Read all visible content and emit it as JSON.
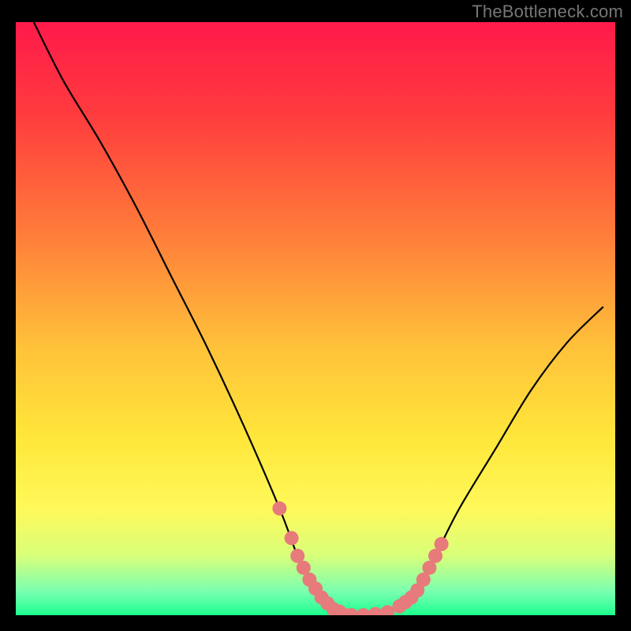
{
  "attribution": "TheBottleneck.com",
  "chart_data": {
    "type": "line",
    "title": "",
    "xlabel": "",
    "ylabel": "",
    "xlim": [
      0,
      100
    ],
    "ylim": [
      0,
      100
    ],
    "curve": {
      "x": [
        3,
        8,
        14,
        20,
        26,
        32,
        38,
        44,
        47,
        49,
        51,
        53,
        55,
        56,
        58,
        60,
        62,
        64,
        66,
        68,
        70,
        74,
        80,
        86,
        92,
        98
      ],
      "y": [
        100,
        90,
        80,
        69,
        57,
        45,
        32,
        18,
        10,
        6,
        3,
        1,
        0,
        0,
        0,
        0,
        0.5,
        1.5,
        3,
        6,
        10,
        18,
        28,
        38,
        46,
        52
      ]
    },
    "highlight_left": {
      "x": [
        44,
        46,
        47,
        48,
        49,
        50,
        51,
        52,
        53,
        54
      ],
      "y": [
        18,
        13,
        10,
        8,
        6,
        4.5,
        3,
        2,
        1,
        0.6
      ]
    },
    "highlight_bottom": {
      "x": [
        55,
        56,
        58,
        60,
        62
      ],
      "y": [
        0,
        0,
        0,
        0.2,
        0.5
      ]
    },
    "highlight_right": {
      "x": [
        64,
        65,
        66,
        67,
        68,
        69,
        70,
        71
      ],
      "y": [
        1.5,
        2.2,
        3,
        4.2,
        6,
        8,
        10,
        12
      ]
    },
    "gradient_stops": [
      {
        "offset": 0.0,
        "color": "#ff1a4b"
      },
      {
        "offset": 0.15,
        "color": "#ff3a3e"
      },
      {
        "offset": 0.35,
        "color": "#ff7a3a"
      },
      {
        "offset": 0.55,
        "color": "#ffc23a"
      },
      {
        "offset": 0.7,
        "color": "#ffe63a"
      },
      {
        "offset": 0.82,
        "color": "#fff95a"
      },
      {
        "offset": 0.9,
        "color": "#d8ff7a"
      },
      {
        "offset": 0.96,
        "color": "#7affb0"
      },
      {
        "offset": 1.0,
        "color": "#1cff8f"
      }
    ],
    "marker_color": "#e77a7a",
    "curve_color": "#000000"
  }
}
